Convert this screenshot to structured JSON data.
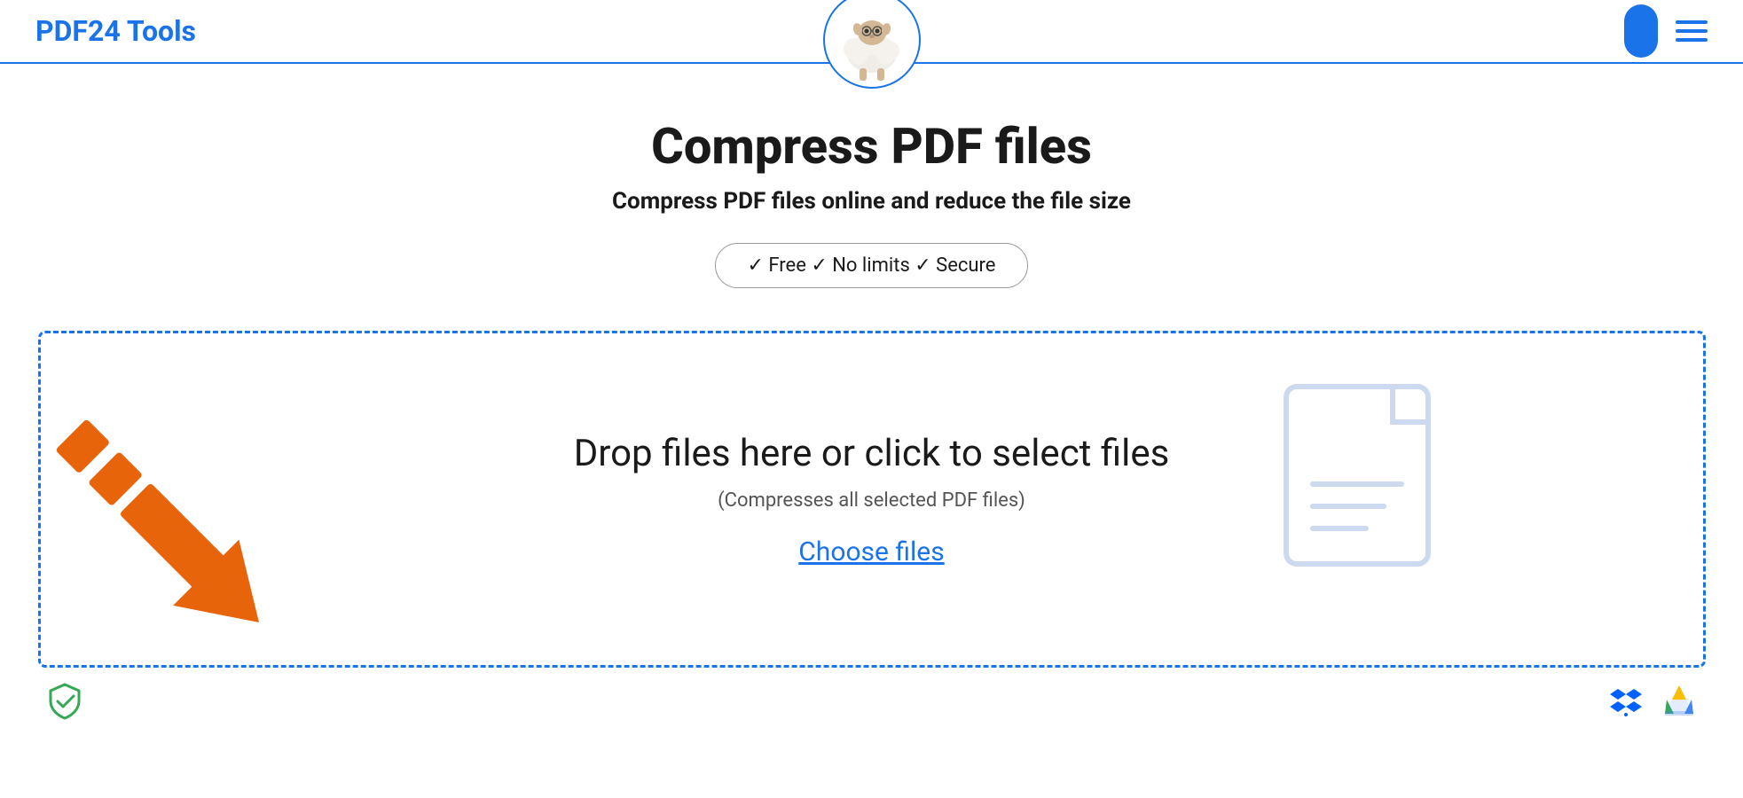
{
  "header": {
    "logo": "PDF24 Tools",
    "user_icon_label": "user-profile",
    "menu_icon_label": "hamburger-menu"
  },
  "page": {
    "title": "Compress PDF files",
    "subtitle": "Compress PDF files online and reduce the file size",
    "features": "✓ Free   ✓ No limits   ✓ Secure",
    "drop_main": "Drop files here or click to select files",
    "drop_sub": "(Compresses all selected PDF files)",
    "choose_files": "Choose files"
  },
  "colors": {
    "brand_blue": "#1a73e8",
    "orange": "#e8640a",
    "green": "#34a853"
  }
}
